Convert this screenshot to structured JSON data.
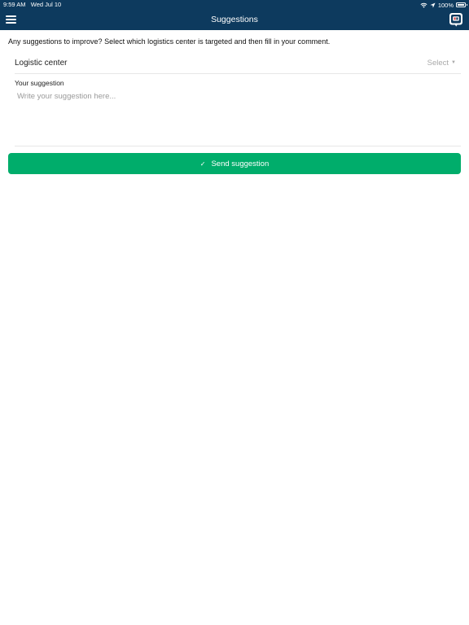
{
  "status_bar": {
    "time": "9:59 AM",
    "date": "Wed Jul 10",
    "battery": "100%"
  },
  "header": {
    "title": "Suggestions",
    "menu_icon": "hamburger-menu-icon",
    "logo_icon": "app-logo-icon"
  },
  "intro_text": "Any suggestions to improve? Select which logistics center is targeted and then fill in your comment.",
  "logistic_center": {
    "label": "Logistic center",
    "value": "Select"
  },
  "suggestion": {
    "label": "Your suggestion",
    "placeholder": "Write your suggestion here...",
    "value": ""
  },
  "send_button": {
    "label": "Send suggestion",
    "icon": "check-icon"
  },
  "colors": {
    "header_bg": "#0d3a5e",
    "button_bg": "#00ad6b"
  }
}
